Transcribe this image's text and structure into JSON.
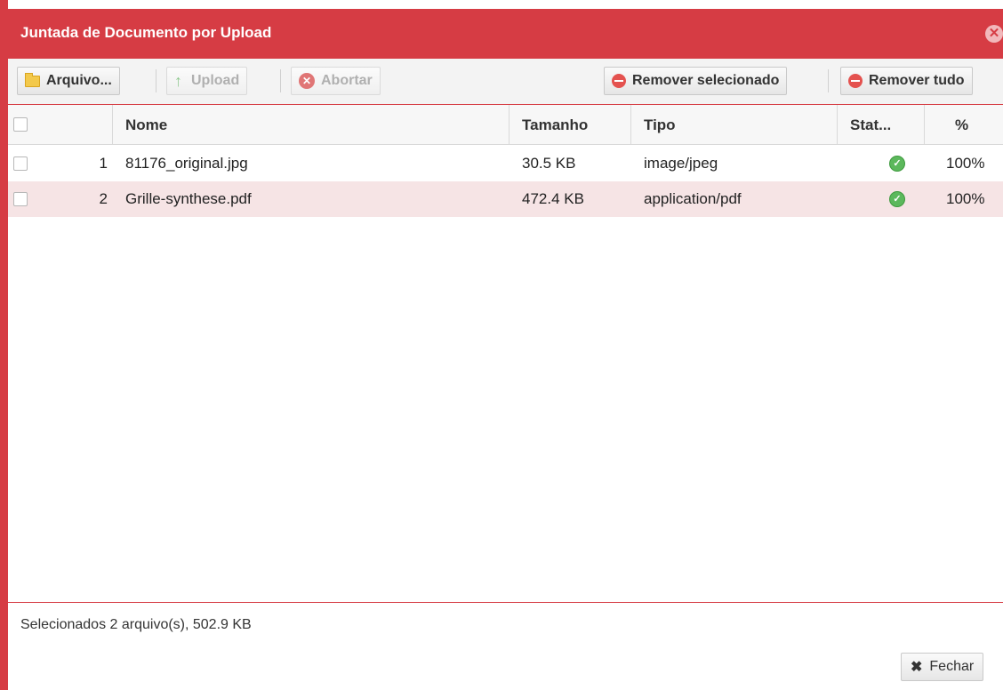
{
  "dialog": {
    "title": "Juntada de Documento por Upload",
    "close_glyph": "✕",
    "accent_color": "#d63c44"
  },
  "toolbar": {
    "arquivo_label": "Arquivo...",
    "upload_label": "Upload",
    "abortar_label": "Abortar",
    "remover_selecionado_label": "Remover selecionado",
    "remover_tudo_label": "Remover tudo"
  },
  "table": {
    "columns": {
      "nome": "Nome",
      "tamanho": "Tamanho",
      "tipo": "Tipo",
      "status": "Stat...",
      "percent": "%"
    },
    "rows": [
      {
        "index": "1",
        "nome": "81176_original.jpg",
        "tamanho": "30.5 KB",
        "tipo": "image/jpeg",
        "status": "ok",
        "percent": "100%"
      },
      {
        "index": "2",
        "nome": "Grille-synthese.pdf",
        "tamanho": "472.4 KB",
        "tipo": "application/pdf",
        "status": "ok",
        "percent": "100%"
      }
    ]
  },
  "footer": {
    "summary": "Selecionados 2 arquivo(s), 502.9 KB",
    "fechar_label": "Fechar"
  }
}
